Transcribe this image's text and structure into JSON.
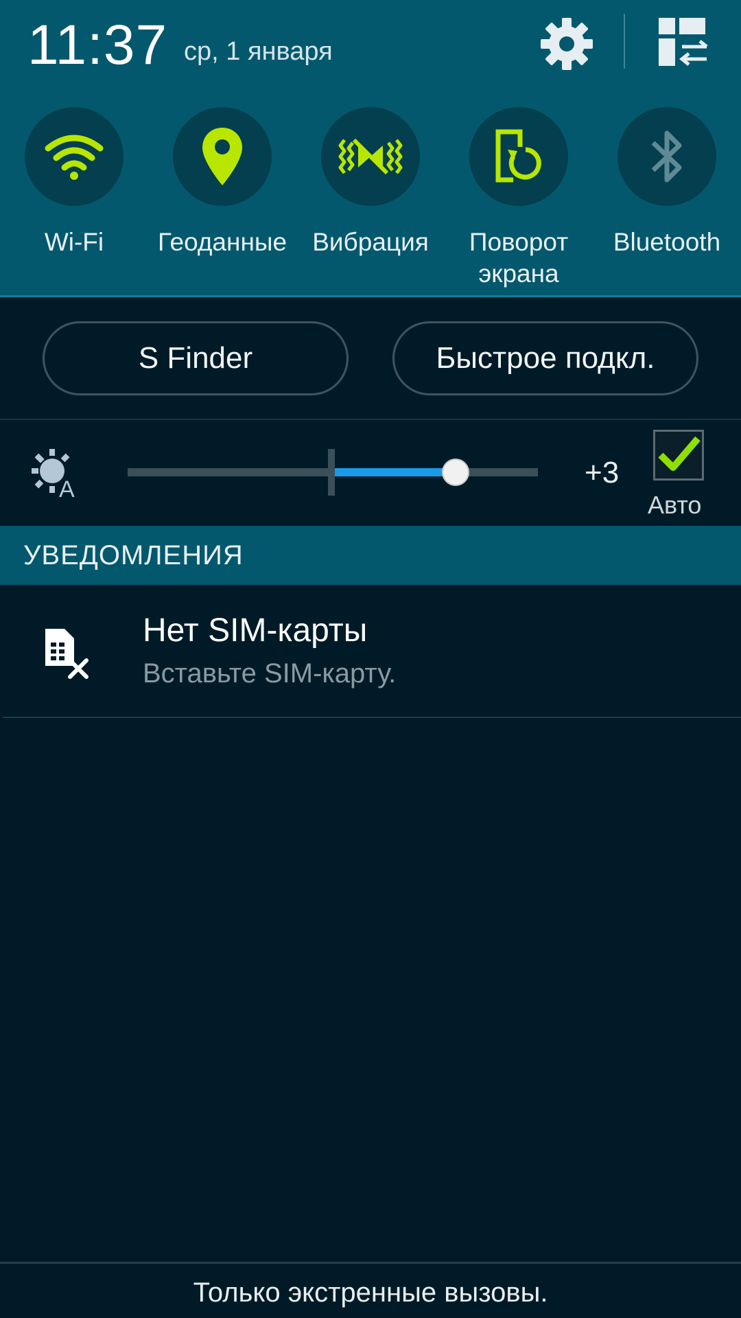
{
  "status": {
    "time": "11:37",
    "date": "ср, 1 января"
  },
  "header_icons": {
    "settings": "gear-icon",
    "edit": "grid-edit-icon"
  },
  "quick_settings": [
    {
      "id": "wifi",
      "label": "Wi-Fi",
      "icon": "wifi-icon",
      "active": true
    },
    {
      "id": "location",
      "label": "Геоданные",
      "icon": "location-pin-icon",
      "active": true
    },
    {
      "id": "vibration",
      "label": "Вибрация",
      "icon": "vibration-icon",
      "active": true
    },
    {
      "id": "rotation",
      "label": "Поворот экрана",
      "icon": "screen-rotation-icon",
      "active": true
    },
    {
      "id": "bluetooth",
      "label": "Bluetooth",
      "icon": "bluetooth-icon",
      "active": false
    }
  ],
  "buttons": {
    "s_finder": "S Finder",
    "quick_connect": "Быстрое подкл."
  },
  "brightness": {
    "icon": "auto-brightness-icon",
    "value_label": "+3",
    "level": 0.8,
    "auto_label": "Авто",
    "auto_checked": true
  },
  "notifications": {
    "header": "УВЕДОМЛЕНИЯ",
    "items": [
      {
        "icon": "no-sim-icon",
        "title": "Нет SIM-карты",
        "text": "Вставьте SIM-карту."
      }
    ]
  },
  "footer": {
    "text": "Только экстренные вызовы."
  },
  "colors": {
    "header_bg": "#04586d",
    "panel_bg": "#001b27",
    "active_icon": "#b8e600",
    "inactive_icon": "#5f8a94",
    "slider_fill": "#1a9bea"
  }
}
